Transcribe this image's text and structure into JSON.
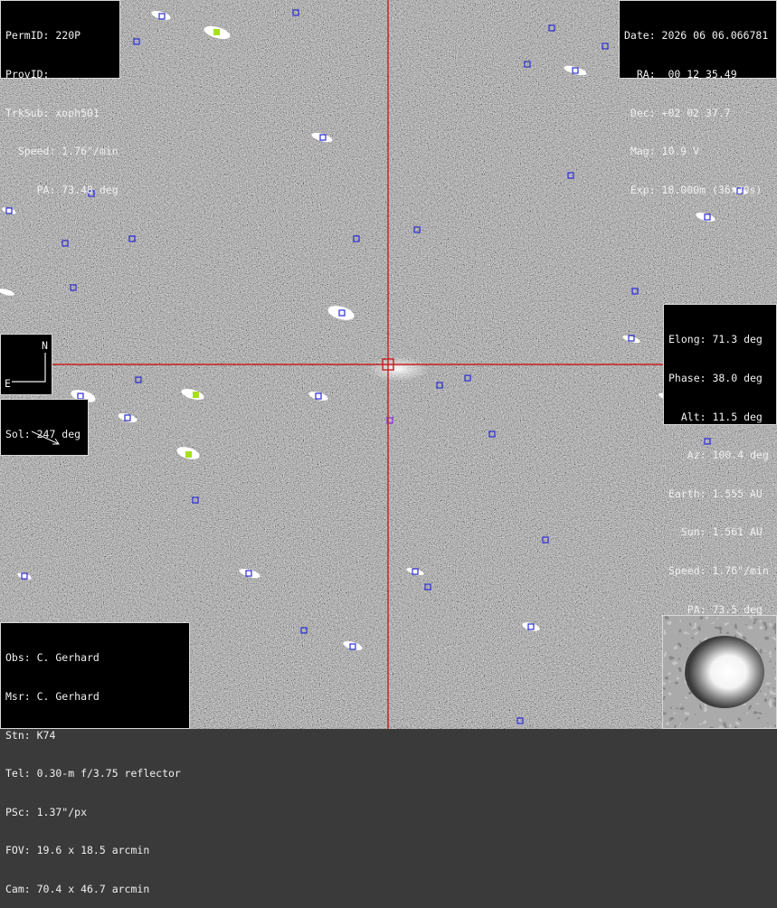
{
  "object_panel": {
    "lines": [
      "PermID: 220P",
      "ProvID:",
      "TrkSub: xoph501",
      "  Speed: 1.76\"/min",
      "     PA: 73.48 deg"
    ]
  },
  "observation_panel": {
    "lines": [
      "Date: 2026 06 06.066781",
      "  RA:  00 12 35.49",
      " Dec: +02 02 37.7",
      " Mag: 10.9 V",
      " Exp: 18.000m (36x30s)"
    ]
  },
  "geometry_panel": {
    "lines": [
      "Elong: 71.3 deg",
      "Phase: 38.0 deg",
      "  Alt: 11.5 deg",
      "   Az: 100.4 deg",
      "Earth: 1.555 AU",
      "  Sun: 1.561 AU",
      "Speed: 1.76\"/min",
      "   PA: 73.5 deg"
    ]
  },
  "observer_panel": {
    "lines": [
      "Obs: C. Gerhard",
      "Msr: C. Gerhard",
      "Stn: K74",
      "Tel: 0.30-m f/3.75 reflector",
      "PSc: 1.37\"/px",
      "FOV: 19.6 x 18.5 arcmin",
      "Cam: 70.4 x 46.7 arcmin"
    ]
  },
  "compass": {
    "north_label": "N",
    "east_label": "E"
  },
  "sol_panel": {
    "label": "Sol: 247 deg"
  },
  "colors": {
    "crosshair": "#c81e1e",
    "catalog_marker": "#2b2bd6",
    "highlight_star": "#a5e01b",
    "panel_bg": "#000000",
    "panel_border": "#d8d8d8"
  },
  "icons": {
    "crosshair": "crosshair-icon",
    "target_box": "target-box-icon",
    "compass_arrows": "compass-arrows-icon",
    "sun_direction_arrow": "sun-direction-arrow-icon"
  }
}
